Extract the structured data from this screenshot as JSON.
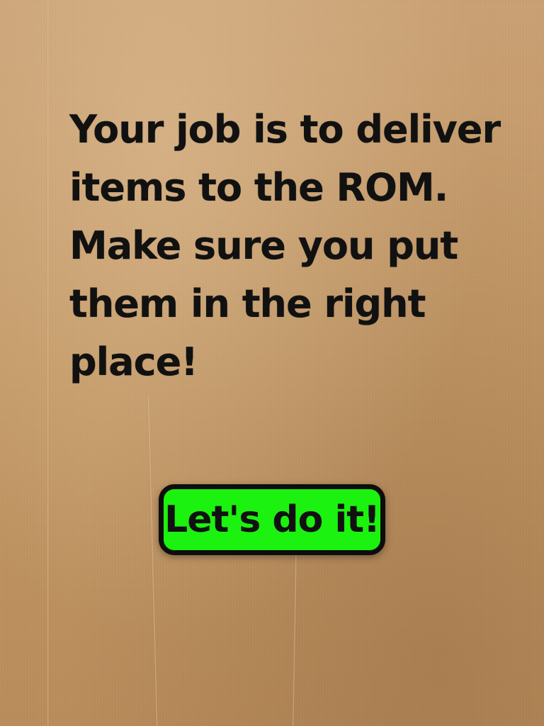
{
  "intro": {
    "lines": [
      "Your job is to deliver",
      "items to the ROM.",
      "Make sure you put",
      "them in the right",
      "place!"
    ]
  },
  "start_button": {
    "label": "Let's do it!"
  },
  "colors": {
    "background": "#c49a6c",
    "button_fill": "#1cf20f",
    "button_border": "#0d0d0d",
    "text": "#111111"
  }
}
